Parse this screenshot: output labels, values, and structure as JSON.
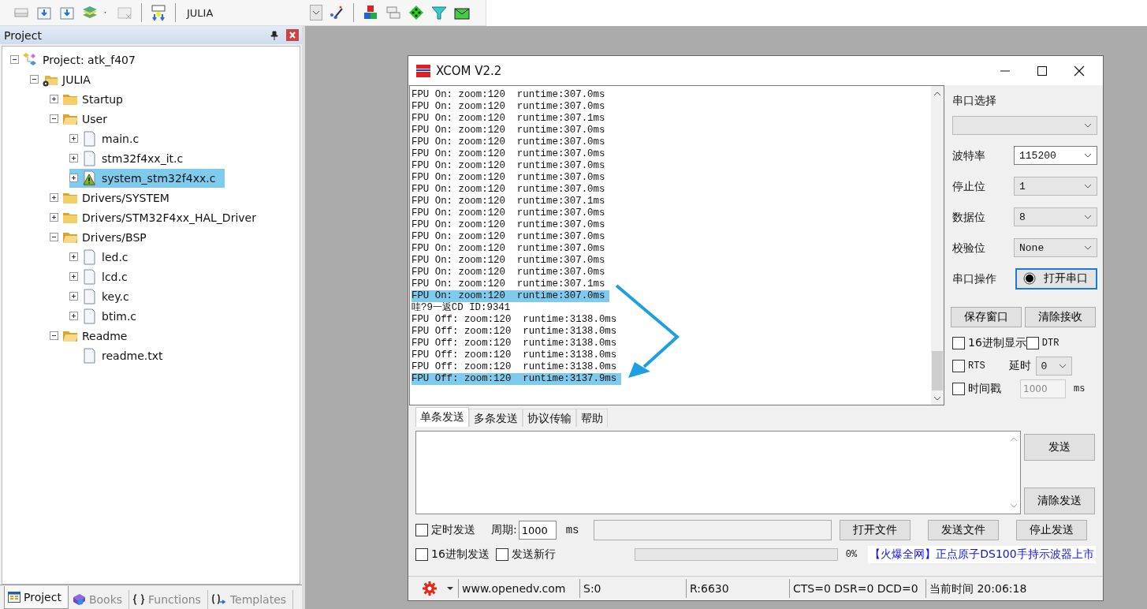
{
  "toolbar": {
    "target": "JULIA"
  },
  "project_panel": {
    "title": "Project",
    "tree": [
      {
        "label": "Project: atk_f407",
        "kind": "project",
        "expanded": true,
        "selected": false,
        "children": [
          {
            "label": "JULIA",
            "kind": "target",
            "expanded": true,
            "selected": false,
            "children": [
              {
                "label": "Startup",
                "kind": "folder",
                "expanded": false,
                "selected": false
              },
              {
                "label": "User",
                "kind": "folder",
                "expanded": true,
                "selected": false,
                "children": [
                  {
                    "label": "main.c",
                    "kind": "file",
                    "expanded": false,
                    "selected": false,
                    "warning": false
                  },
                  {
                    "label": "stm32f4xx_it.c",
                    "kind": "file",
                    "expanded": false,
                    "selected": false,
                    "warning": false
                  },
                  {
                    "label": "system_stm32f4xx.c",
                    "kind": "file",
                    "expanded": false,
                    "selected": true,
                    "warning": true
                  }
                ]
              },
              {
                "label": "Drivers/SYSTEM",
                "kind": "folder",
                "expanded": false,
                "selected": false
              },
              {
                "label": "Drivers/STM32F4xx_HAL_Driver",
                "kind": "folder",
                "expanded": false,
                "selected": false
              },
              {
                "label": "Drivers/BSP",
                "kind": "folder",
                "expanded": true,
                "selected": false,
                "children": [
                  {
                    "label": "led.c",
                    "kind": "file",
                    "expanded": false,
                    "selected": false,
                    "warning": false
                  },
                  {
                    "label": "lcd.c",
                    "kind": "file",
                    "expanded": false,
                    "selected": false,
                    "warning": false
                  },
                  {
                    "label": "key.c",
                    "kind": "file",
                    "expanded": false,
                    "selected": false,
                    "warning": false
                  },
                  {
                    "label": "btim.c",
                    "kind": "file",
                    "expanded": false,
                    "selected": false,
                    "warning": false
                  }
                ]
              },
              {
                "label": "Readme",
                "kind": "folder",
                "expanded": true,
                "selected": false,
                "children": [
                  {
                    "label": "readme.txt",
                    "kind": "file",
                    "selected": false,
                    "warning": false
                  }
                ]
              }
            ]
          }
        ]
      }
    ],
    "tabs": [
      {
        "label": "Project",
        "kind": "project",
        "selected": true
      },
      {
        "label": "Books",
        "kind": "books",
        "selected": false
      },
      {
        "label": "Functions",
        "kind": "functions",
        "selected": false
      },
      {
        "label": "Templates",
        "kind": "templates",
        "selected": false
      }
    ]
  },
  "xcom": {
    "title": "XCOM V2.2",
    "log": [
      {
        "text": "FPU On: zoom:120  runtime:307.0ms",
        "highlighted": false
      },
      {
        "text": "FPU On: zoom:120  runtime:307.0ms",
        "highlighted": false
      },
      {
        "text": "FPU On: zoom:120  runtime:307.1ms",
        "highlighted": false
      },
      {
        "text": "FPU On: zoom:120  runtime:307.0ms",
        "highlighted": false
      },
      {
        "text": "FPU On: zoom:120  runtime:307.0ms",
        "highlighted": false
      },
      {
        "text": "FPU On: zoom:120  runtime:307.0ms",
        "highlighted": false
      },
      {
        "text": "FPU On: zoom:120  runtime:307.0ms",
        "highlighted": false
      },
      {
        "text": "FPU On: zoom:120  runtime:307.0ms",
        "highlighted": false
      },
      {
        "text": "FPU On: zoom:120  runtime:307.0ms",
        "highlighted": false
      },
      {
        "text": "FPU On: zoom:120  runtime:307.1ms",
        "highlighted": false
      },
      {
        "text": "FPU On: zoom:120  runtime:307.0ms",
        "highlighted": false
      },
      {
        "text": "FPU On: zoom:120  runtime:307.0ms",
        "highlighted": false
      },
      {
        "text": "FPU On: zoom:120  runtime:307.0ms",
        "highlighted": false
      },
      {
        "text": "FPU On: zoom:120  runtime:307.0ms",
        "highlighted": false
      },
      {
        "text": "FPU On: zoom:120  runtime:307.0ms",
        "highlighted": false
      },
      {
        "text": "FPU On: zoom:120  runtime:307.0ms",
        "highlighted": false
      },
      {
        "text": "FPU On: zoom:120  runtime:307.1ms",
        "highlighted": false
      },
      {
        "text": "FPU On: zoom:120  runtime:307.0ms",
        "highlighted": true
      },
      {
        "text": "哇?9一返CD ID:9341",
        "highlighted": false
      },
      {
        "text": "FPU Off: zoom:120  runtime:3138.0ms",
        "highlighted": false
      },
      {
        "text": "FPU Off: zoom:120  runtime:3138.0ms",
        "highlighted": false
      },
      {
        "text": "FPU Off: zoom:120  runtime:3138.0ms",
        "highlighted": false
      },
      {
        "text": "FPU Off: zoom:120  runtime:3138.0ms",
        "highlighted": false
      },
      {
        "text": "FPU Off: zoom:120  runtime:3138.0ms",
        "highlighted": false
      },
      {
        "text": "FPU Off: zoom:120  runtime:3137.9ms",
        "highlighted": true
      }
    ],
    "port": {
      "label": "串口选择"
    },
    "settings": [
      {
        "label": "波特率",
        "value": "115200",
        "editable": true
      },
      {
        "label": "停止位",
        "value": "1",
        "editable": false
      },
      {
        "label": "数据位",
        "value": "8",
        "editable": false
      },
      {
        "label": "校验位",
        "value": "None",
        "editable": false
      }
    ],
    "serial_op": {
      "label": "串口操作",
      "button": "打开串口"
    },
    "panel_buttons": [
      "保存窗口",
      "清除接收"
    ],
    "hex_display": {
      "label": "16进制显示",
      "checked": false
    },
    "dtr": {
      "label": "DTR",
      "checked": false
    },
    "rts": {
      "label": "RTS",
      "checked": false
    },
    "delay": {
      "label": "延时",
      "value": "0"
    },
    "timestamp": {
      "label": "时间戳",
      "checked": false
    },
    "timestamp_interval": {
      "value": "1000",
      "unit": "ms"
    },
    "send_tabs": [
      {
        "label": "单条发送",
        "selected": true
      },
      {
        "label": "多条发送",
        "selected": false
      },
      {
        "label": "协议传输",
        "selected": false
      },
      {
        "label": "帮助",
        "selected": false
      }
    ],
    "send_buttons": [
      "发送",
      "清除发送"
    ],
    "timed_send": {
      "label": "定时发送",
      "checked": false
    },
    "period": {
      "label": "周期:",
      "value": "1000",
      "unit": "ms"
    },
    "file_buttons": [
      "打开文件",
      "发送文件",
      "停止发送"
    ],
    "hex_send": {
      "label": "16进制发送",
      "checked": false
    },
    "send_newline": {
      "label": "发送新行",
      "checked": false
    },
    "progress": {
      "level": 0,
      "reading": "0%"
    },
    "ad": "【火爆全网】正点原子DS100手持示波器上市",
    "status": [
      "www.openedv.com",
      "S:0",
      "R:6630",
      "CTS=0 DSR=0 DCD=0",
      "当前时间 20:06:18"
    ]
  }
}
